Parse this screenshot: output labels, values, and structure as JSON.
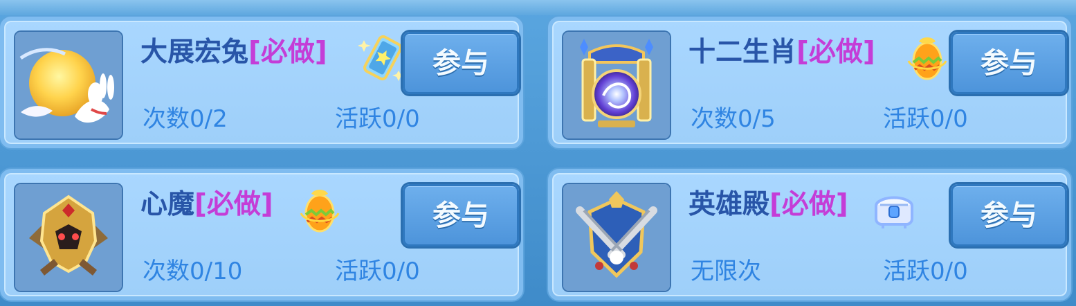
{
  "activities": [
    {
      "title": "大展宏兔",
      "tag": "[必做]",
      "button": "参与",
      "count_text": "次数0/2",
      "activity_text": "活跃0/0",
      "icon": "rabbit-moon-icon",
      "reward_icon": "blue-card-icon"
    },
    {
      "title": "十二生肖",
      "tag": "[必做]",
      "button": "参与",
      "count_text": "次数0/5",
      "activity_text": "活跃0/0",
      "icon": "zodiac-portal-icon",
      "reward_icon": "gold-egg-icon"
    },
    {
      "title": "心魔",
      "tag": "[必做]",
      "button": "参与",
      "count_text": "次数0/10",
      "activity_text": "活跃0/0",
      "icon": "demon-helmet-icon",
      "reward_icon": "gold-egg-icon"
    },
    {
      "title": "英雄殿",
      "tag": "[必做]",
      "button": "参与",
      "count_text": "无限次",
      "activity_text": "活跃0/0",
      "icon": "hero-shield-icon",
      "reward_icon": "silver-chest-icon"
    }
  ]
}
